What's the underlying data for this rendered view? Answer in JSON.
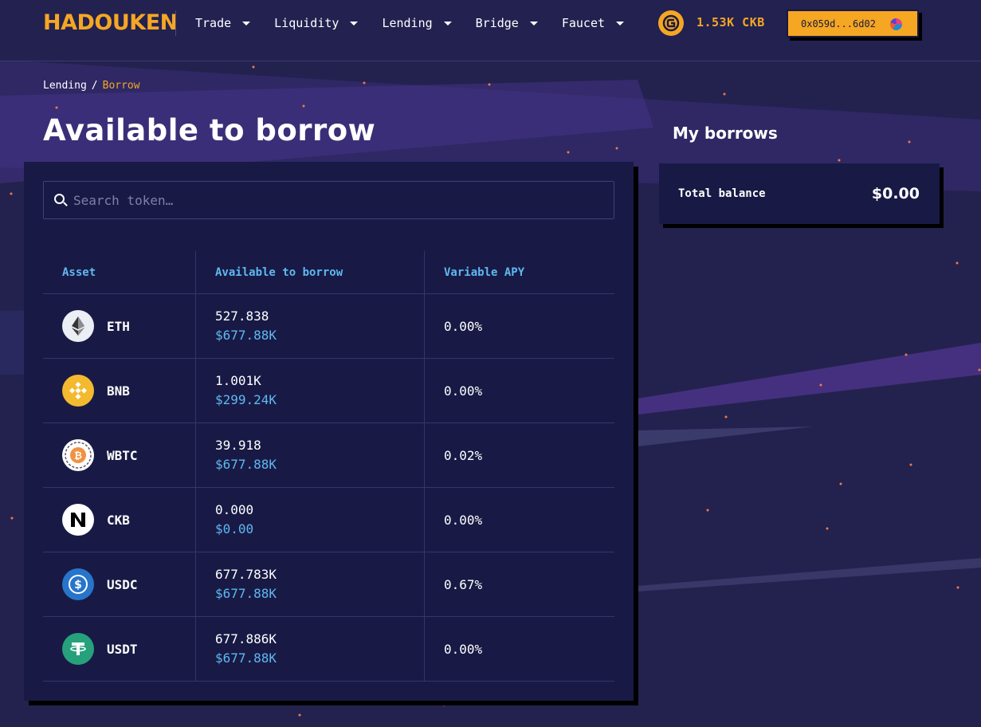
{
  "header": {
    "logo_text": "HADOUKEN",
    "nav": [
      {
        "label": "Trade"
      },
      {
        "label": "Liquidity"
      },
      {
        "label": "Lending"
      },
      {
        "label": "Bridge"
      },
      {
        "label": "Faucet"
      }
    ],
    "balance": "1.53K CKB",
    "wallet_address": "0x059d...6d02"
  },
  "breadcrumb": {
    "root": "Lending",
    "separator": "/",
    "current": "Borrow"
  },
  "page_title": "Available to borrow",
  "search": {
    "placeholder": "Search token…",
    "value": ""
  },
  "table": {
    "headers": [
      "Asset",
      "Available to borrow",
      "Variable APY"
    ],
    "rows": [
      {
        "asset": "ETH",
        "available": "527.838",
        "usd": "$677.88K",
        "apy": "0.00%",
        "icon": "eth-icon"
      },
      {
        "asset": "BNB",
        "available": "1.001K",
        "usd": "$299.24K",
        "apy": "0.00%",
        "icon": "bnb-icon"
      },
      {
        "asset": "WBTC",
        "available": "39.918",
        "usd": "$677.88K",
        "apy": "0.02%",
        "icon": "wbtc-icon"
      },
      {
        "asset": "CKB",
        "available": "0.000",
        "usd": "$0.00",
        "apy": "0.00%",
        "icon": "ckb-icon"
      },
      {
        "asset": "USDC",
        "available": "677.783K",
        "usd": "$677.88K",
        "apy": "0.67%",
        "icon": "usdc-icon"
      },
      {
        "asset": "USDT",
        "available": "677.886K",
        "usd": "$677.88K",
        "apy": "0.00%",
        "icon": "usdt-icon"
      }
    ]
  },
  "my_borrows": {
    "title": "My borrows",
    "total_label": "Total balance",
    "total_value": "$0.00"
  },
  "colors": {
    "accent": "#f5a623",
    "link_blue": "#5fb8f0",
    "background": "#23224f",
    "panel": "#181a45"
  }
}
